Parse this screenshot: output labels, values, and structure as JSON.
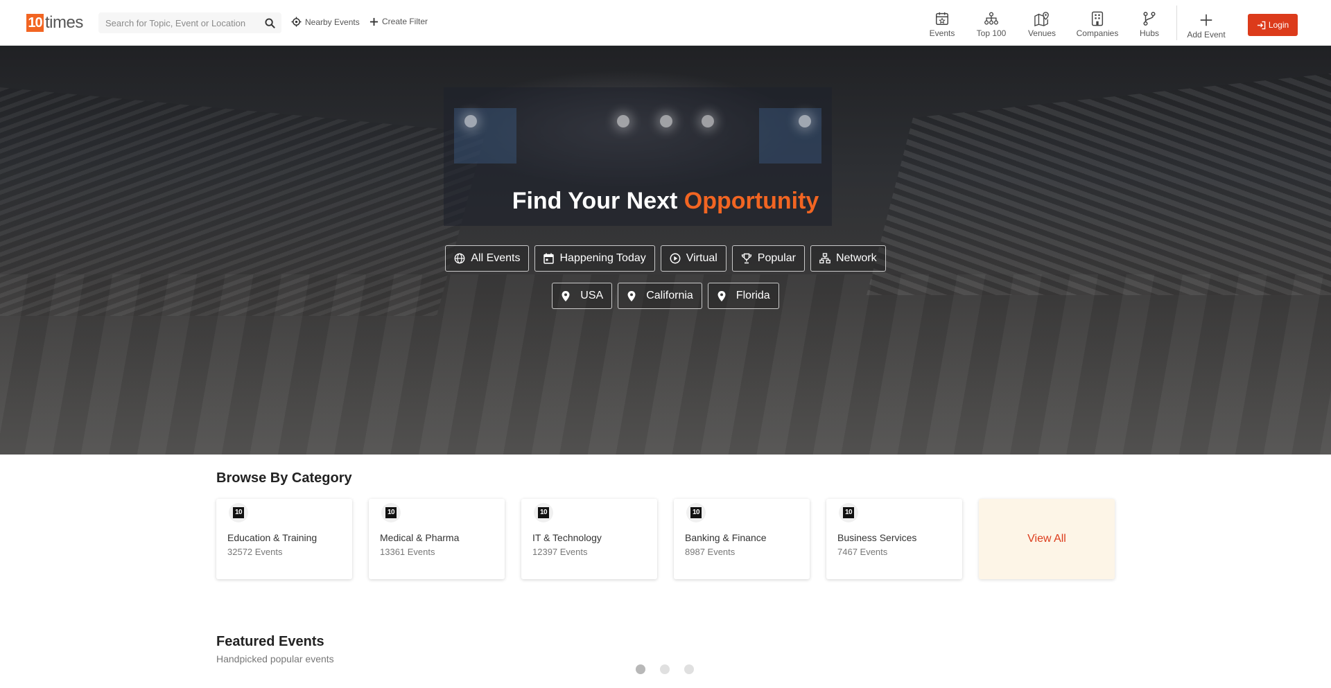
{
  "brand": {
    "logo_number": "10",
    "logo_word": "times",
    "accent_color": "#f26522",
    "login_color": "#dc3b1b"
  },
  "search": {
    "placeholder": "Search for Topic, Event or Location"
  },
  "header_links": {
    "nearby": "Nearby Events",
    "create_filter": "Create Filter"
  },
  "nav": [
    {
      "label": "Events",
      "icon": "calendar-star-icon"
    },
    {
      "label": "Top 100",
      "icon": "hierarchy-icon"
    },
    {
      "label": "Venues",
      "icon": "map-pin-icon"
    },
    {
      "label": "Companies",
      "icon": "building-icon"
    },
    {
      "label": "Hubs",
      "icon": "branch-icon"
    }
  ],
  "add_event": {
    "label": "Add Event"
  },
  "login": {
    "label": "Login"
  },
  "hero": {
    "title_main": "Find Your Next ",
    "title_accent": "Opportunity",
    "chips": [
      {
        "label": "All Events",
        "icon": "globe-icon"
      },
      {
        "label": "Happening Today",
        "icon": "calendar-icon"
      },
      {
        "label": "Virtual",
        "icon": "play-circle-icon"
      },
      {
        "label": "Popular",
        "icon": "trophy-icon"
      },
      {
        "label": "Network",
        "icon": "network-icon"
      }
    ],
    "locations": [
      {
        "label": "USA",
        "icon": "location-pin-icon"
      },
      {
        "label": "California",
        "icon": "location-pin-icon"
      },
      {
        "label": "Florida",
        "icon": "location-pin-icon"
      }
    ]
  },
  "browse": {
    "title": "Browse By Category",
    "categories": [
      {
        "name": "Education & Training",
        "count": "32572 Events",
        "badge": "10"
      },
      {
        "name": "Medical & Pharma",
        "count": "13361 Events",
        "badge": "10"
      },
      {
        "name": "IT & Technology",
        "count": "12397 Events",
        "badge": "10"
      },
      {
        "name": "Banking & Finance",
        "count": "8987 Events",
        "badge": "10"
      },
      {
        "name": "Business Services",
        "count": "7467 Events",
        "badge": "10"
      }
    ],
    "view_all": "View All"
  },
  "featured": {
    "title": "Featured Events",
    "subtitle": "Handpicked popular events",
    "carousel_pages": 3,
    "active_page": 1
  }
}
